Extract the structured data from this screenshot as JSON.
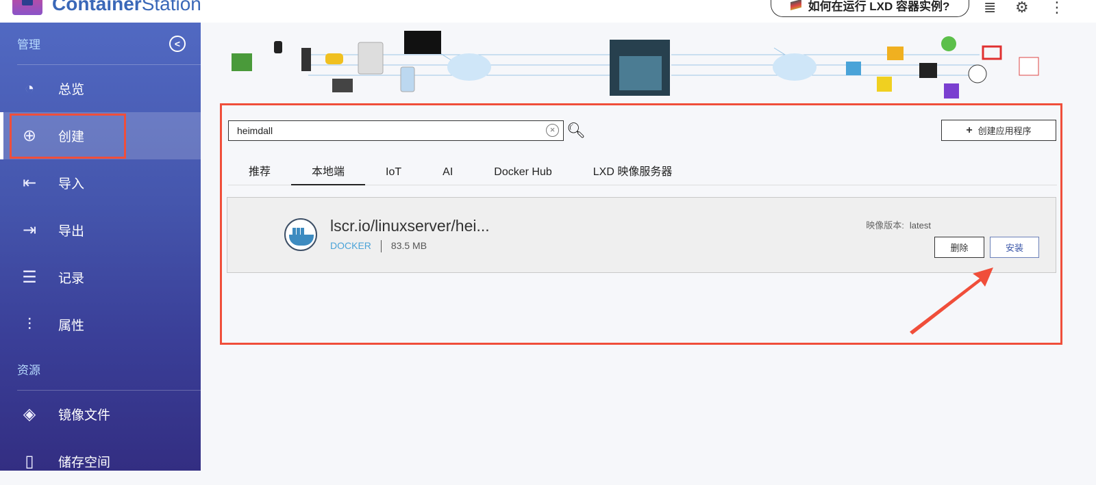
{
  "app": {
    "name_bold": "Container",
    "name_light": "Station"
  },
  "topbar": {
    "help_label": "如何在运行 LXD 容器实例?",
    "icons": [
      "book-icon",
      "stack-icon",
      "gear-icon",
      "more-vertical-icon"
    ]
  },
  "sidebar": {
    "section_manage": "管理",
    "manage_items": [
      {
        "label": "总览",
        "icon": "dashboard-icon"
      },
      {
        "label": "创建",
        "icon": "plus-circle-icon"
      },
      {
        "label": "导入",
        "icon": "import-icon"
      },
      {
        "label": "导出",
        "icon": "export-icon"
      },
      {
        "label": "记录",
        "icon": "log-icon"
      },
      {
        "label": "属性",
        "icon": "sliders-icon"
      }
    ],
    "section_resources": "资源",
    "resource_items": [
      {
        "label": "镜像文件",
        "icon": "layers-icon"
      },
      {
        "label": "储存空间",
        "icon": "storage-icon"
      }
    ]
  },
  "search": {
    "value": "heimdall"
  },
  "create_app_label": "创建应用程序",
  "tabs": [
    "推荐",
    "本地端",
    "IoT",
    "AI",
    "Docker Hub",
    "LXD 映像服务器"
  ],
  "active_tab": "本地端",
  "result": {
    "name": "lscr.io/linuxserver/hei...",
    "type": "DOCKER",
    "size": "83.5 MB",
    "version_label": "映像版本:",
    "version": "latest",
    "delete_label": "删除",
    "install_label": "安装"
  },
  "colors": {
    "highlight": "#f04e3a",
    "accent": "#3a56a8",
    "docker": "#4aa3d8"
  }
}
